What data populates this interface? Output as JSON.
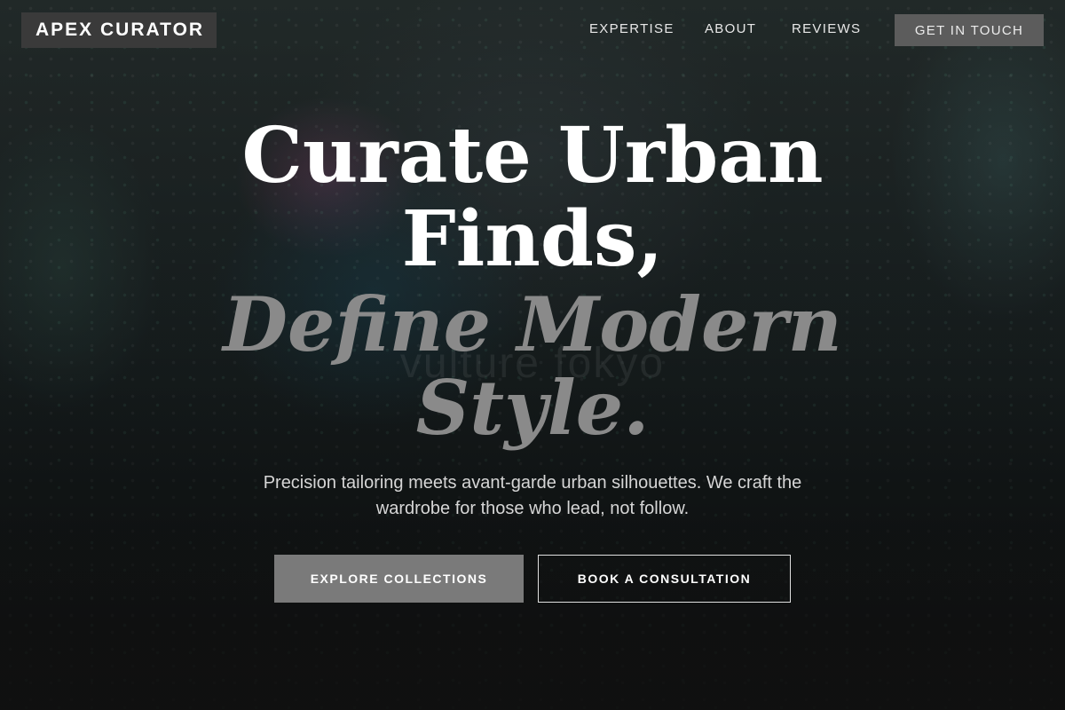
{
  "header": {
    "brand": "APEX CURATOR",
    "nav": [
      "EXPERTISE",
      "ABOUT",
      "REVIEWS"
    ],
    "cta": "GET IN TOUCH"
  },
  "hero": {
    "headline_line1": "Curate Urban",
    "headline_line2": "Finds,",
    "headline_line3": "Define Modern",
    "headline_line4": "Style.",
    "subtitle": "Precision tailoring meets avant-garde urban silhouettes. We craft the wardrobe for those who lead, not follow.",
    "primary_button": "EXPLORE COLLECTIONS",
    "secondary_button": "BOOK A CONSULTATION",
    "background_watermark": "vulture fokyo"
  },
  "colors": {
    "brand_box": "#3a3a3a",
    "cta_bg": "#5c5c5c",
    "primary_button_bg": "#7a7a7a",
    "headline_accent": "#8a8a8a",
    "text": "#ffffff"
  }
}
